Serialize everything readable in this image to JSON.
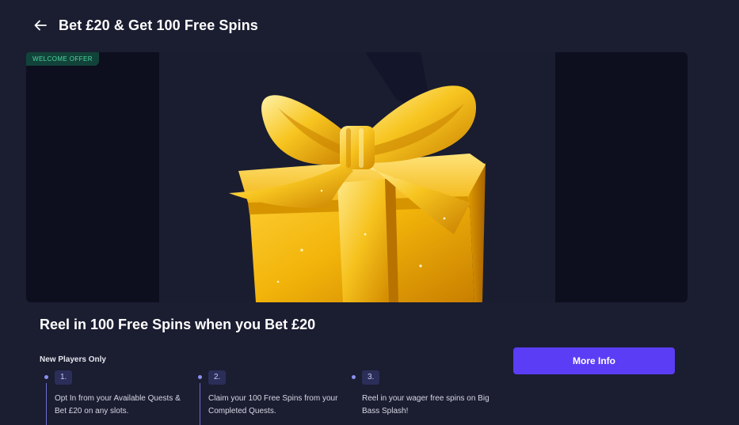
{
  "header": {
    "back_icon": "arrow-left-icon",
    "title": "Bet £20 & Get 100 Free Spins"
  },
  "banner": {
    "badge": "WELCOME OFFER",
    "art_icon": "gold-gift-box-icon",
    "colors": {
      "gold": "#f2b80c",
      "gold_dark": "#c98200",
      "gold_light": "#ffe27a"
    }
  },
  "promo": {
    "heading": "Reel in 100 Free Spins when you Bet £20",
    "subheading": "New Players Only",
    "more_info_label": "More Info",
    "accent": "#5b3df6"
  },
  "steps": [
    {
      "number": "1.",
      "text": "Opt In from your Available Quests & Bet £20 on any slots."
    },
    {
      "number": "2.",
      "text": "Claim your 100 Free Spins from your Completed Quests."
    },
    {
      "number": "3.",
      "text": "Reel in your wager free spins on Big Bass Splash!"
    }
  ]
}
